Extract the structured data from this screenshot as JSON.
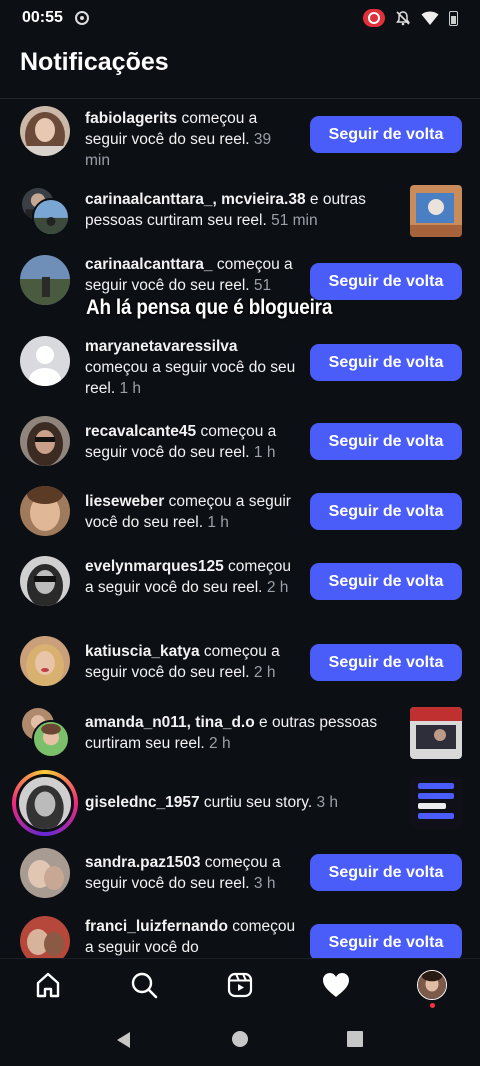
{
  "status_bar": {
    "time": "00:55"
  },
  "header": {
    "title": "Notificações"
  },
  "overlay_caption": "Ah lá pensa que é blogueira",
  "notifications": [
    {
      "user": "fabiolagerits",
      "text": " começou a seguir você do seu reel.",
      "time": "39 min",
      "action": "Seguir de volta"
    },
    {
      "user": "carinaalcanttara_, mcvieira.38",
      "text": " e outras pessoas curtiram seu reel.",
      "time": "51 min"
    },
    {
      "user": "carinaalcanttara_",
      "text": " começou a seguir você do seu reel.",
      "time": "51",
      "action": "Seguir de volta"
    },
    {
      "user": "maryanetavaressilva",
      "text": " começou a seguir você do seu reel.",
      "time": "1 h",
      "action": "Seguir de volta"
    },
    {
      "user": "recavalcante45",
      "text": " começou a seguir você do seu reel.",
      "time": "1 h",
      "action": "Seguir de volta"
    },
    {
      "user": "lieseweber",
      "text": " começou a seguir você do seu reel.",
      "time": "1 h",
      "action": "Seguir de volta"
    },
    {
      "user": "evelynmarques125",
      "text": " começou a seguir você do seu reel.",
      "time": "2 h",
      "action": "Seguir de volta"
    },
    {
      "user": "katiuscia_katya",
      "text": " começou a seguir você do seu reel.",
      "time": "2 h",
      "action": "Seguir de volta"
    },
    {
      "user": "amanda_n011, tina_d.o",
      "text": " e outras pessoas curtiram seu reel.",
      "time": "2 h"
    },
    {
      "user": "giselednc_1957",
      "text": " curtiu seu story.",
      "time": "3 h"
    },
    {
      "user": "sandra.paz1503",
      "text": " começou a seguir você do seu reel.",
      "time": "3 h",
      "action": "Seguir de volta"
    },
    {
      "user": "franci_luizfernando",
      "text": " começou a seguir você do",
      "time": "",
      "action": "Seguir de volta"
    }
  ],
  "colors": {
    "background": "#0c0f14",
    "button": "#4a5df9",
    "muted": "#9aa0a8",
    "notification_dot": "#ff3040"
  },
  "bottom_nav": {
    "icons": [
      "home-icon",
      "search-icon",
      "reels-icon",
      "heart-icon",
      "profile-avatar"
    ]
  },
  "system_nav": {
    "icons": [
      "back-icon",
      "home-circle-icon",
      "recents-icon"
    ]
  }
}
